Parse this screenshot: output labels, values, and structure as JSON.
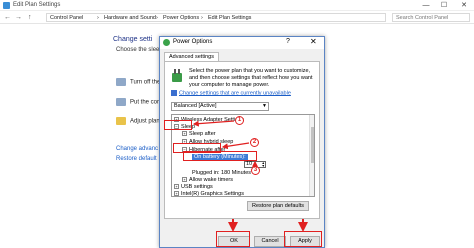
{
  "background": {
    "title": "Edit Plan Settings",
    "controls": [
      "—",
      "☐",
      "✕"
    ],
    "nav": [
      "←",
      "→",
      "↑"
    ],
    "breadcrumbs": [
      "Control Panel",
      "›",
      "Hardware and Sound",
      "›",
      "Power Options",
      "›",
      "Edit Plan Settings"
    ],
    "search_placeholder": "Search Control Panel",
    "heading": "Change setti",
    "subheading": "Choose the sleep",
    "rows": [
      "Turn off the",
      "Put the comp",
      "Adjust plan"
    ],
    "links": [
      "Change advanc",
      "Restore default"
    ]
  },
  "dialog": {
    "title": "Power Options",
    "help": "?",
    "close": "✕",
    "tab": "Advanced settings",
    "description": "Select the power plan that you want to customize, and then choose settings that reflect how you want your computer to manage power.",
    "change_link": "Change settings that are currently unavailable",
    "plan": "Balanced [Active]",
    "tree": {
      "wireless": "Wireless Adapter Settings",
      "sleep": "Sleep",
      "sleep_after": "Sleep after",
      "hybrid": "Allow hybrid sleep",
      "hibernate": "Hibernate after",
      "on_battery": "On battery (Minutes):",
      "on_battery_value": "10",
      "plugged": "Plugged in: 180 Minutes",
      "wake": "Allow wake timers",
      "usb": "USB settings",
      "intel": "Intel(R) Graphics Settings"
    },
    "restore": "Restore plan defaults",
    "ok": "OK",
    "cancel": "Cancel",
    "apply": "Apply"
  },
  "annotations": [
    "1",
    "2",
    "3"
  ],
  "colors": {
    "annotation": "#e02020",
    "selection": "#3d7bd6",
    "link": "#1a5dc7"
  }
}
